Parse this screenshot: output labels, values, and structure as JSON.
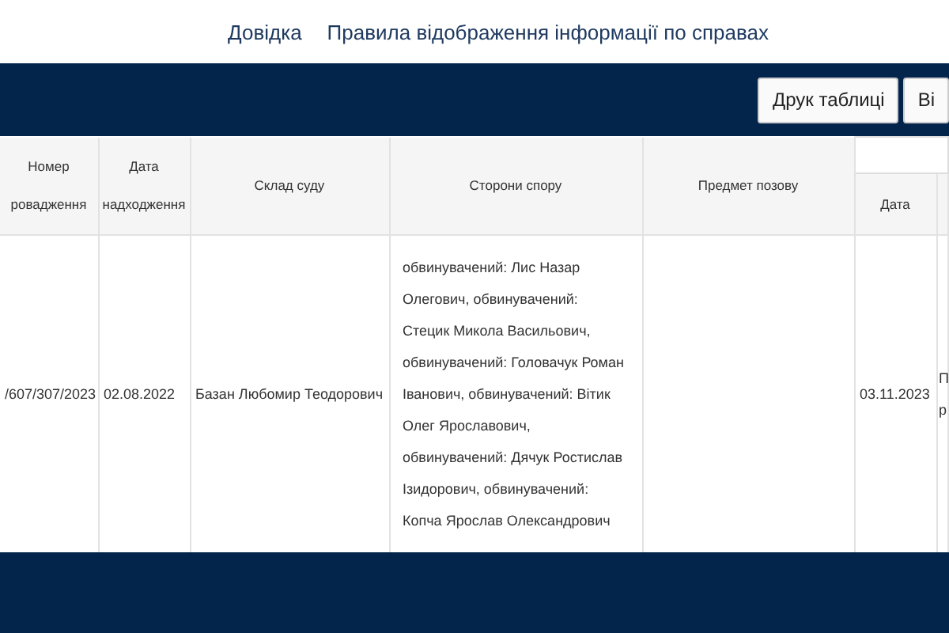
{
  "top_links": [
    "Довідка",
    "Правила відображення інформації по справах"
  ],
  "toolbar": {
    "buttons": [
      "Друк таблиці",
      "Ві"
    ]
  },
  "table": {
    "columns": [
      {
        "lines": [
          "Номер",
          "ровадження"
        ]
      },
      {
        "lines": [
          "Дата",
          "надходження"
        ]
      },
      {
        "lines": [
          "Склад суду"
        ]
      },
      {
        "lines": [
          "Сторони спору"
        ]
      },
      {
        "lines": [
          "Предмет позову"
        ]
      }
    ],
    "group_column": {
      "sub_columns": [
        "Дата"
      ]
    },
    "rows": [
      {
        "cells": [
          "/607/307/2023",
          "02.08.2022",
          "Базан Любомир Теодорович",
          "обвинувачений: Лис Назар Олегович, обвинувачений: Стецик Микола Васильович, обвинувачений: Головачук Роман Іванович, обвинувачений: Вітик Олег Ярославович, обвинувачений: Дячук Ростислав Ізидорович, обвинувачений: Копча Ярослав Олександрович",
          "",
          "03.11.2023"
        ],
        "last_cell_lines": [
          "П",
          "р"
        ]
      }
    ]
  }
}
